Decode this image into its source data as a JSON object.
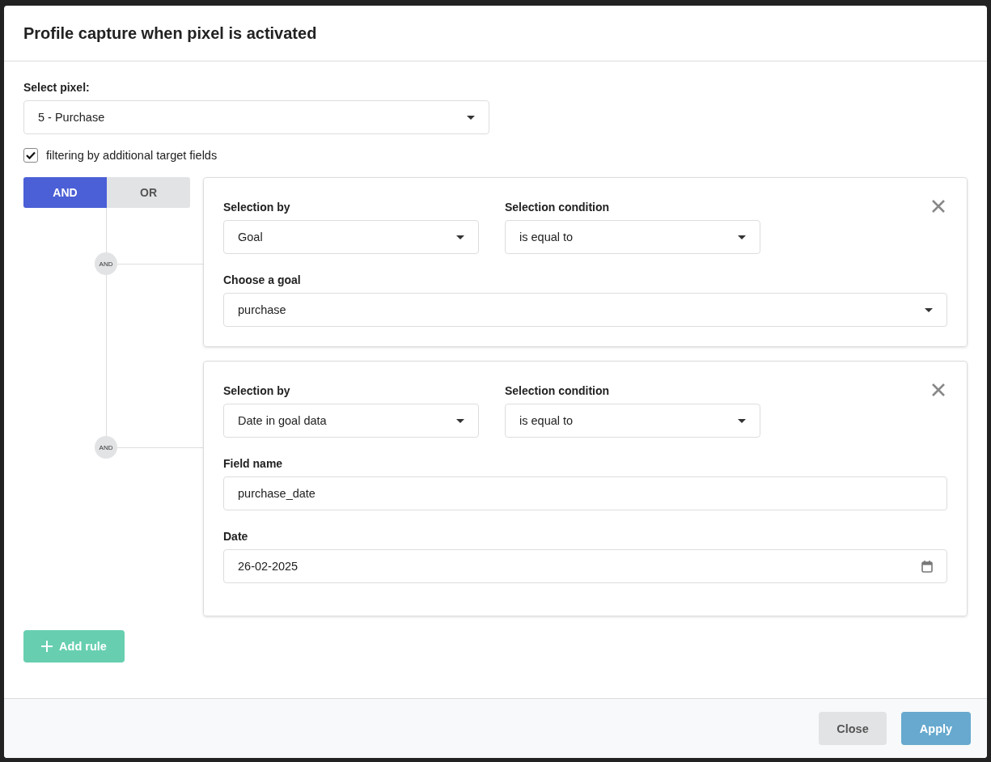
{
  "dialog": {
    "title": "Profile capture when pixel is activated"
  },
  "pixel_select": {
    "label": "Select pixel:",
    "value": "5 - Purchase"
  },
  "filter_checkbox": {
    "label": "filtering by additional target fields",
    "checked": true
  },
  "logic_toggle": [
    {
      "label": "AND",
      "selected": true
    },
    {
      "label": "OR",
      "selected": false
    }
  ],
  "rules": [
    {
      "connector": "AND",
      "top_fields": [
        {
          "label": "Selection by",
          "value": "Goal"
        },
        {
          "label": "Selection condition",
          "value": "is equal to"
        }
      ],
      "fields": [
        {
          "kind": "select",
          "label": "Choose a goal",
          "value": "purchase"
        }
      ]
    },
    {
      "connector": "AND",
      "top_fields": [
        {
          "label": "Selection by",
          "value": "Date in goal data"
        },
        {
          "label": "Selection condition",
          "value": "is equal to"
        }
      ],
      "fields": [
        {
          "kind": "text",
          "label": "Field name",
          "value": "purchase_date"
        },
        {
          "kind": "date",
          "label": "Date",
          "value": "26-02-2025"
        }
      ]
    }
  ],
  "add_rule_button": {
    "label": "Add rule"
  },
  "footer_buttons": [
    {
      "label": "Close",
      "kind": "secondary"
    },
    {
      "label": "Apply",
      "kind": "primary"
    }
  ]
}
